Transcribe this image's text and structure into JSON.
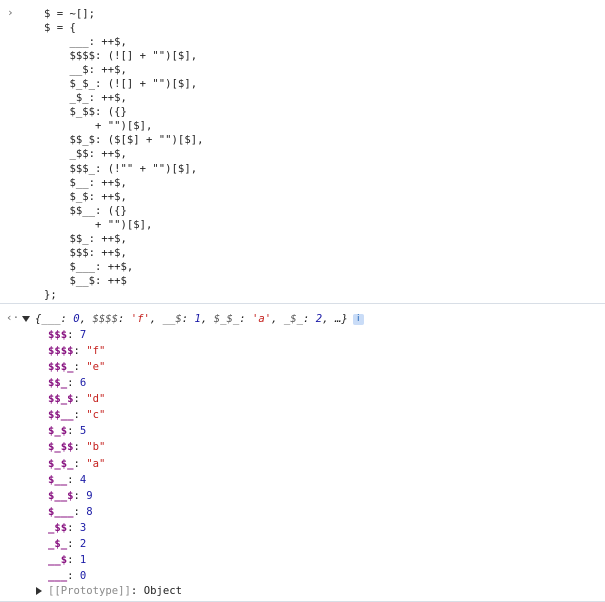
{
  "input": {
    "prompt_glyph": "›",
    "code_lines": [
      "$ = ~[];",
      "$ = {",
      "    ___: ++$,",
      "    $$$$: (![] + \"\")[$],",
      "    __$: ++$,",
      "    $_$_: (![] + \"\")[$],",
      "    _$_: ++$,",
      "    $_$$: ({}",
      "        + \"\")[$],",
      "    $$_$: ($[$] + \"\")[$],",
      "    _$$: ++$,",
      "    $$$_: (!\"\" + \"\")[$],",
      "    $__: ++$,",
      "    $_$: ++$,",
      "    $$__: ({}",
      "        + \"\")[$],",
      "    $$_: ++$,",
      "    $$$: ++$,",
      "    $___: ++$,",
      "    $__$: ++$",
      "};"
    ]
  },
  "result": {
    "result_glyph": "‹·",
    "summary": {
      "open": "{",
      "items": [
        {
          "key": "___",
          "value": "0",
          "kind": "num"
        },
        {
          "key": "$$$$",
          "value": "'f'",
          "kind": "str"
        },
        {
          "key": "__$",
          "value": "1",
          "kind": "num"
        },
        {
          "key": "$_$_",
          "value": "'a'",
          "kind": "str"
        },
        {
          "key": "_$_",
          "value": "2",
          "kind": "num"
        }
      ],
      "ellipsis": "…}",
      "info_badge": "i"
    },
    "properties": [
      {
        "key": "$$$",
        "value": "7",
        "kind": "num"
      },
      {
        "key": "$$$$",
        "value": "\"f\"",
        "kind": "str"
      },
      {
        "key": "$$$_",
        "value": "\"e\"",
        "kind": "str"
      },
      {
        "key": "$$_",
        "value": "6",
        "kind": "num"
      },
      {
        "key": "$$_$",
        "value": "\"d\"",
        "kind": "str"
      },
      {
        "key": "$$__",
        "value": "\"c\"",
        "kind": "str"
      },
      {
        "key": "$_$",
        "value": "5",
        "kind": "num"
      },
      {
        "key": "$_$$",
        "value": "\"b\"",
        "kind": "str"
      },
      {
        "key": "$_$_",
        "value": "\"a\"",
        "kind": "str"
      },
      {
        "key": "$__",
        "value": "4",
        "kind": "num"
      },
      {
        "key": "$__$",
        "value": "9",
        "kind": "num"
      },
      {
        "key": "$___",
        "value": "8",
        "kind": "num"
      },
      {
        "key": "_$$",
        "value": "3",
        "kind": "num"
      },
      {
        "key": "_$_",
        "value": "2",
        "kind": "num"
      },
      {
        "key": "__$",
        "value": "1",
        "kind": "num"
      },
      {
        "key": "___",
        "value": "0",
        "kind": "num"
      }
    ],
    "prototype": {
      "key": "[[Prototype]]",
      "value": "Object"
    }
  },
  "colors": {
    "property_key": "#881280",
    "number": "#1a1aa6",
    "string": "#c5221f",
    "divider": "#d8dee6"
  }
}
